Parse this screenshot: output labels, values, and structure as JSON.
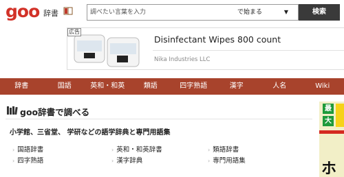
{
  "header": {
    "logo": "goo",
    "logo_sub": "辞書",
    "search_placeholder": "調べたい言葉を入力",
    "search_mode": "で始まる",
    "search_button": "検索"
  },
  "ad": {
    "tag": "広告",
    "title": "Disinfectant Wipes 800 count",
    "company": "Nika Industries LLC"
  },
  "nav": {
    "items": [
      "辞書",
      "国語",
      "英和・和英",
      "類語",
      "四字熟語",
      "漢字",
      "人名",
      "Wiki"
    ]
  },
  "main": {
    "title": "goo辞書で調べる",
    "subtitle": "小学館、三省堂、 学研などの語学辞典と専門用語集",
    "links": [
      "国語辞書",
      "英和・和英辞書",
      "類語辞書",
      "四字熟語",
      "漢字辞典",
      "専門用語集"
    ]
  },
  "side_ad": {
    "badge1": "最",
    "badge2": "大",
    "big_text": "ホ"
  },
  "colors": {
    "logo_red": "#d23228",
    "nav_bg": "#a8432c",
    "search_button_bg": "#3a3a3a"
  }
}
